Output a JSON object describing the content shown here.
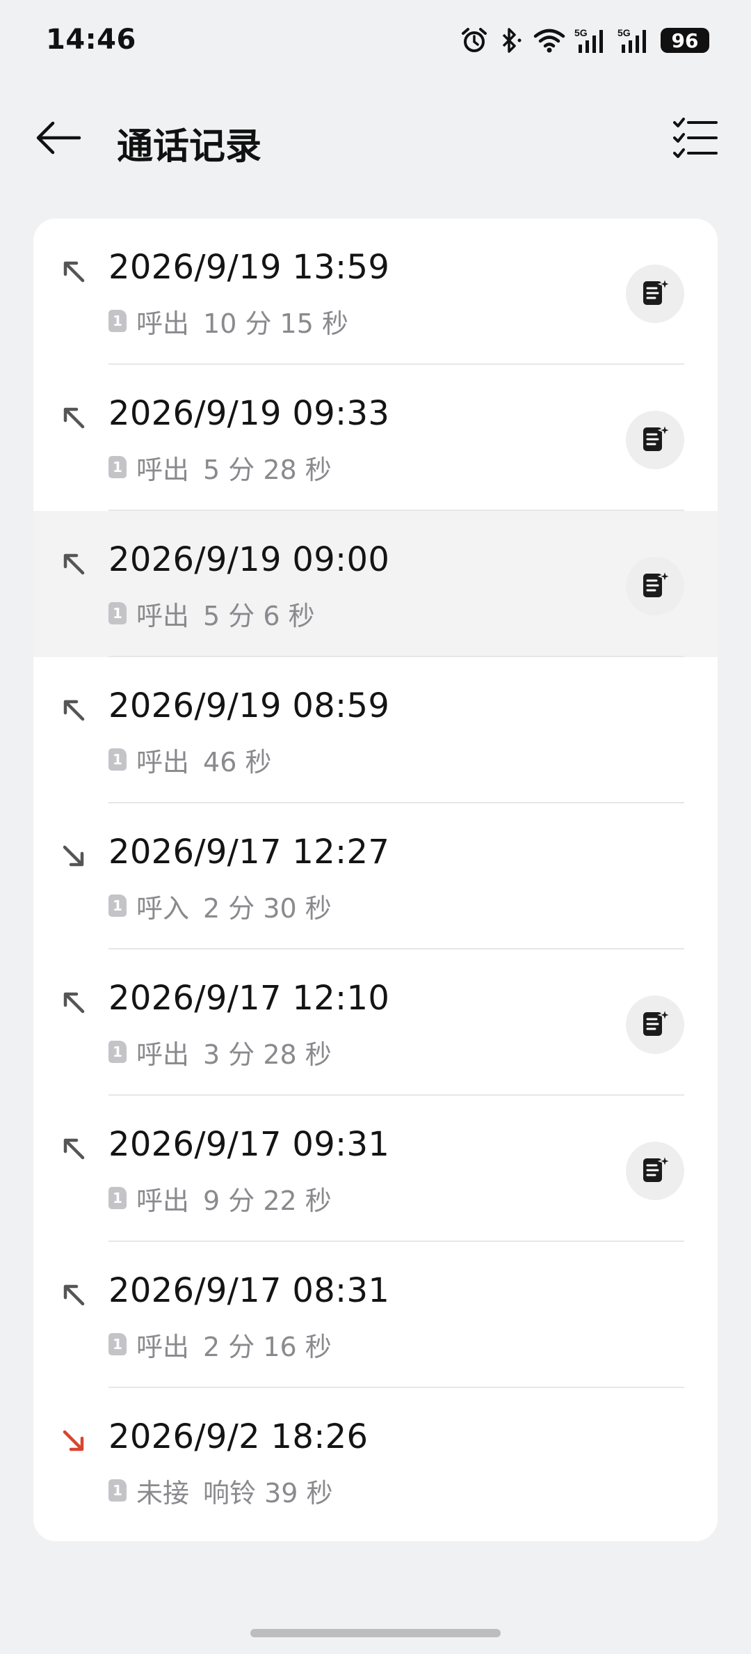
{
  "status_bar": {
    "time": "14:46",
    "battery": "96",
    "icons": [
      "alarm-icon",
      "bluetooth-icon",
      "wifi-icon",
      "signal-5g-icon",
      "signal-5g-icon"
    ]
  },
  "header": {
    "title": "通话记录",
    "back_icon": "back-arrow-icon",
    "action_icon": "multiselect-list-icon"
  },
  "colors": {
    "background": "#f0f1f3",
    "card": "#ffffff",
    "missed": "#d9442f",
    "normal_icon": "#555555",
    "secondary_text": "#8a8a8e"
  },
  "calls": [
    {
      "time": "2026/9/19 13:59",
      "sim": "1",
      "type": "呼出",
      "detail": "10 分 15 秒",
      "direction": "outgoing",
      "has_summary": true,
      "pressed": false
    },
    {
      "time": "2026/9/19 09:33",
      "sim": "1",
      "type": "呼出",
      "detail": "5 分 28 秒",
      "direction": "outgoing",
      "has_summary": true,
      "pressed": false
    },
    {
      "time": "2026/9/19 09:00",
      "sim": "1",
      "type": "呼出",
      "detail": "5 分 6 秒",
      "direction": "outgoing",
      "has_summary": true,
      "pressed": true
    },
    {
      "time": "2026/9/19 08:59",
      "sim": "1",
      "type": "呼出",
      "detail": "46 秒",
      "direction": "outgoing",
      "has_summary": false,
      "pressed": false
    },
    {
      "time": "2026/9/17 12:27",
      "sim": "1",
      "type": "呼入",
      "detail": "2 分 30 秒",
      "direction": "incoming",
      "has_summary": false,
      "pressed": false
    },
    {
      "time": "2026/9/17 12:10",
      "sim": "1",
      "type": "呼出",
      "detail": "3 分 28 秒",
      "direction": "outgoing",
      "has_summary": true,
      "pressed": false
    },
    {
      "time": "2026/9/17 09:31",
      "sim": "1",
      "type": "呼出",
      "detail": "9 分 22 秒",
      "direction": "outgoing",
      "has_summary": true,
      "pressed": false
    },
    {
      "time": "2026/9/17 08:31",
      "sim": "1",
      "type": "呼出",
      "detail": "2 分 16 秒",
      "direction": "outgoing",
      "has_summary": false,
      "pressed": false
    },
    {
      "time": "2026/9/2 18:26",
      "sim": "1",
      "type": "未接",
      "detail": "响铃 39 秒",
      "direction": "missed",
      "has_summary": false,
      "pressed": false
    }
  ]
}
